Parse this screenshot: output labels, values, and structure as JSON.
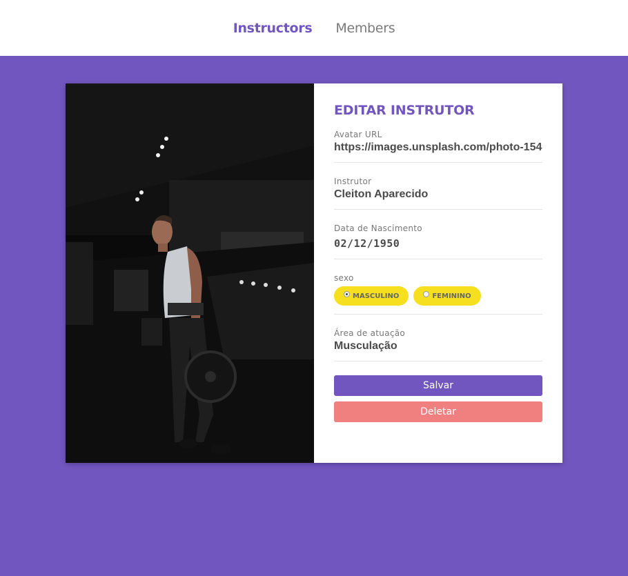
{
  "nav": {
    "items": [
      {
        "label": "Instructors",
        "active": true
      },
      {
        "label": "Members",
        "active": false
      }
    ]
  },
  "form": {
    "title": "EDITAR INSTRUTOR",
    "avatar": {
      "label": "Avatar URL",
      "value": "https://images.unsplash.com/photo-154"
    },
    "name": {
      "label": "Instrutor",
      "value": "Cleiton Aparecido"
    },
    "birth": {
      "label": "Data de Nascimento",
      "value": "02/12/1950"
    },
    "gender": {
      "label": "sexo",
      "options": [
        {
          "label": "MASCULINO",
          "checked": true
        },
        {
          "label": "FEMININO",
          "checked": false
        }
      ]
    },
    "area": {
      "label": "Área de atuação",
      "value": "Musculação"
    },
    "save_label": "Salvar",
    "delete_label": "Deletar"
  },
  "colors": {
    "primary": "#7156bf",
    "accent_yellow": "#f5df1e",
    "danger": "#f08080"
  }
}
